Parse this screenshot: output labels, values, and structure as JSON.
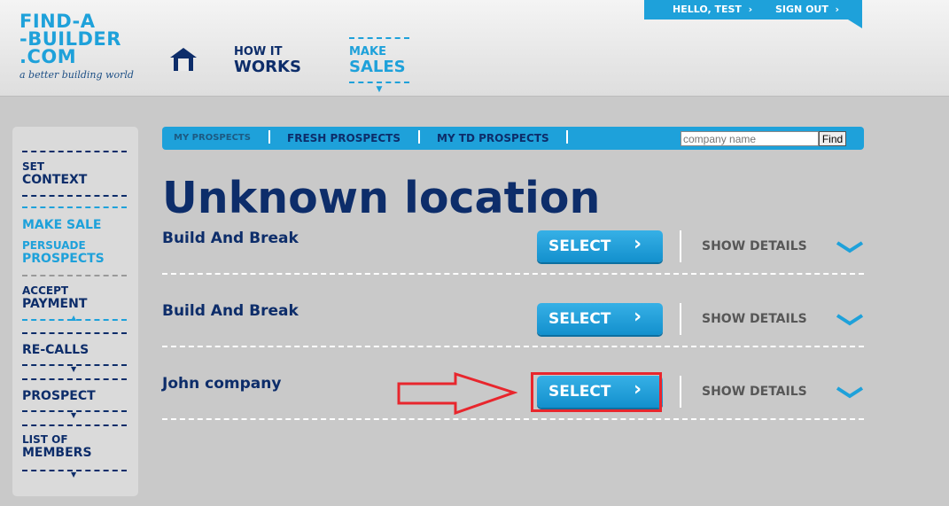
{
  "logo": {
    "line1": "FIND-A",
    "line2": "-BUILDER",
    "line3": ".COM",
    "tagline": "a better building world"
  },
  "nav": {
    "how_small": "HOW IT",
    "how_large": "WORKS",
    "make_small": "MAKE",
    "make_large": "SALES"
  },
  "user": {
    "hello": "HELLO, TEST",
    "signout": "SIGN OUT",
    "arrow": "›"
  },
  "sidebar": {
    "set_small": "SET",
    "set_large": "CONTEXT",
    "make_sale": "MAKE SALE",
    "persuade_small": "PERSUADE",
    "persuade_large": "PROSPECTS",
    "accept_small": "ACCEPT",
    "accept_large": "PAYMENT",
    "recalls": "RE-CALLS",
    "prospect": "PROSPECT",
    "list_small": "LIST OF",
    "list_large": "MEMBERS"
  },
  "tabs": {
    "my": "MY PROSPECTS",
    "fresh": "FRESH PROSPECTS",
    "td": "MY TD PROSPECTS",
    "search_placeholder": "company name",
    "find": "Find"
  },
  "heading": "Unknown location",
  "rows": [
    {
      "name": "Build And Break",
      "select": "SELECT",
      "details": "SHOW DETAILS"
    },
    {
      "name": "Build And Break",
      "select": "SELECT",
      "details": "SHOW DETAILS"
    },
    {
      "name": "John company",
      "select": "SELECT",
      "details": "SHOW DETAILS"
    }
  ],
  "colors": {
    "navy": "#0d2d6a",
    "blue": "#1ea1da",
    "red": "#e8262d",
    "background": "#c9c9c9"
  },
  "icons": {
    "home": "home-icon",
    "select_arrow": "chevron-right-icon",
    "details": "chevron-down-icon",
    "annotation": "red-arrow-icon"
  }
}
